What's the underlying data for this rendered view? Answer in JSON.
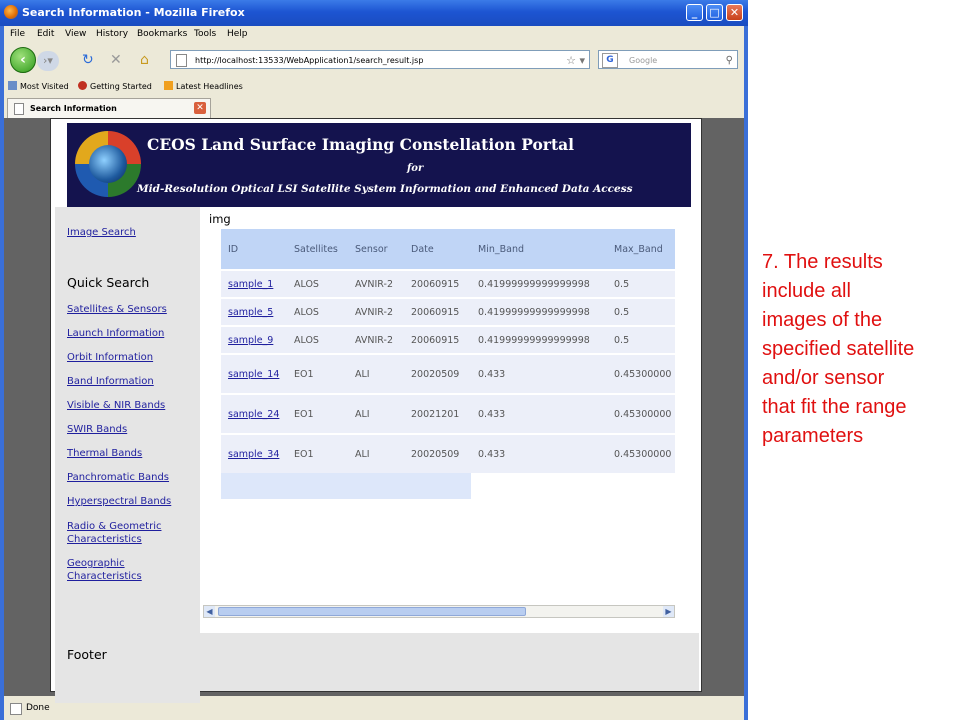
{
  "window": {
    "title": "Search Information - Mozilla Firefox"
  },
  "menu": [
    "File",
    "Edit",
    "View",
    "History",
    "Bookmarks",
    "Tools",
    "Help"
  ],
  "nav": {
    "url": "http://localhost:13533/WebApplication1/search_result.jsp",
    "search_placeholder": "Google"
  },
  "bookmarks": [
    "Most Visited",
    "Getting Started",
    "Latest Headlines"
  ],
  "tab": {
    "label": "Search Information"
  },
  "banner": {
    "title": "CEOS Land Surface Imaging Constellation Portal",
    "for": "for",
    "subtitle": "Mid-Resolution Optical LSI Satellite System Information and Enhanced Data Access"
  },
  "sidebar": {
    "image_search": "Image Search",
    "quick_search": "Quick Search",
    "links": [
      "Satellites & Sensors",
      "Launch Information",
      "Orbit Information",
      "Band Information",
      "Visible & NIR Bands",
      "SWIR Bands",
      "Thermal Bands",
      "Panchromatic Bands",
      "Hyperspectral Bands",
      "Radio & Geometric Characteristics",
      "Geographic Characteristics"
    ]
  },
  "main": {
    "img_label": "img",
    "table": {
      "columns": [
        "ID",
        "Satellites",
        "Sensor",
        "Date",
        "Min_Band",
        "Max_Band"
      ],
      "rows": [
        [
          "sample_1",
          "ALOS",
          "AVNIR-2",
          "20060915",
          "0.41999999999999998",
          "0.5"
        ],
        [
          "sample_5",
          "ALOS",
          "AVNIR-2",
          "20060915",
          "0.41999999999999998",
          "0.5"
        ],
        [
          "sample_9",
          "ALOS",
          "AVNIR-2",
          "20060915",
          "0.41999999999999998",
          "0.5"
        ],
        [
          "sample_14",
          "EO1",
          "ALI",
          "20020509",
          "0.433",
          "0.45300000"
        ],
        [
          "sample_24",
          "EO1",
          "ALI",
          "20021201",
          "0.433",
          "0.45300000"
        ],
        [
          "sample_34",
          "EO1",
          "ALI",
          "20020509",
          "0.433",
          "0.45300000"
        ]
      ]
    }
  },
  "footer": {
    "text": "Footer"
  },
  "status": {
    "text": "Done"
  },
  "annotation": {
    "lines": [
      "7. The results",
      "include all",
      "images of the",
      "specified satellite",
      "and/or sensor",
      "that fit the range",
      "parameters"
    ]
  },
  "colors": {
    "titlebar": "#1d55d2",
    "banner": "#14134e",
    "annotation": "#e01010",
    "table_header": "#c0d5f6"
  }
}
